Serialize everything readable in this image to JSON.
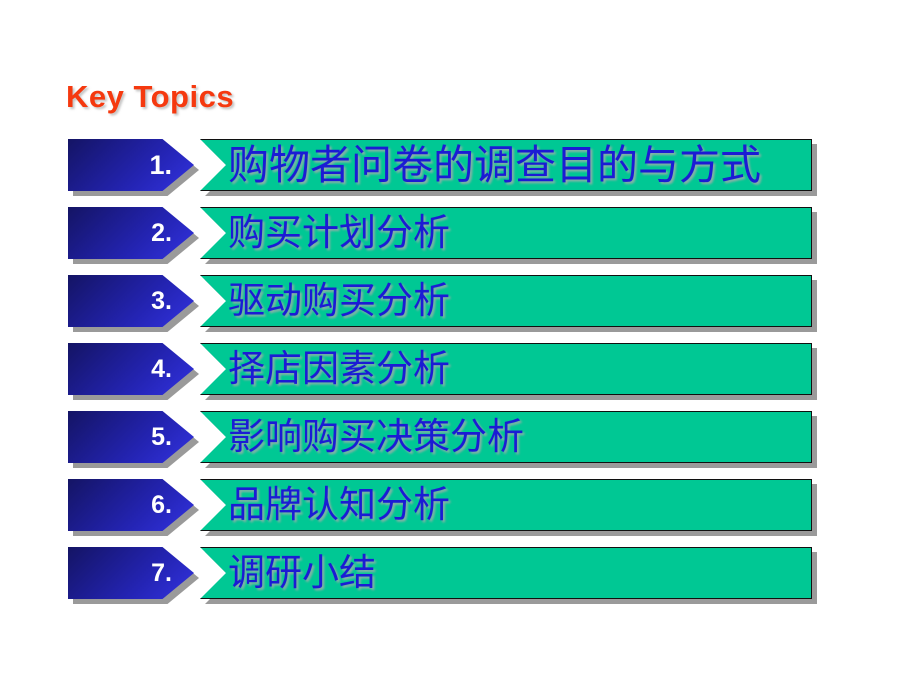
{
  "slide": {
    "title": "Key Topics",
    "title_color": "#F5390F",
    "background_color": "#FFFFFF",
    "bar_color": "#00C894",
    "arrow_color_dark": "#141464",
    "arrow_color_light": "#3535DC",
    "label_color": "#1B1BD4",
    "number_color": "#FFFFFF"
  },
  "topics": [
    {
      "number": "1.",
      "label": "购物者问卷的调查目的与方式"
    },
    {
      "number": "2.",
      "label": "购买计划分析"
    },
    {
      "number": "3.",
      "label": "驱动购买分析"
    },
    {
      "number": "4.",
      "label": "择店因素分析"
    },
    {
      "number": "5.",
      "label": "影响购买决策分析"
    },
    {
      "number": "6.",
      "label": "品牌认知分析"
    },
    {
      "number": "7.",
      "label": "调研小结"
    }
  ]
}
